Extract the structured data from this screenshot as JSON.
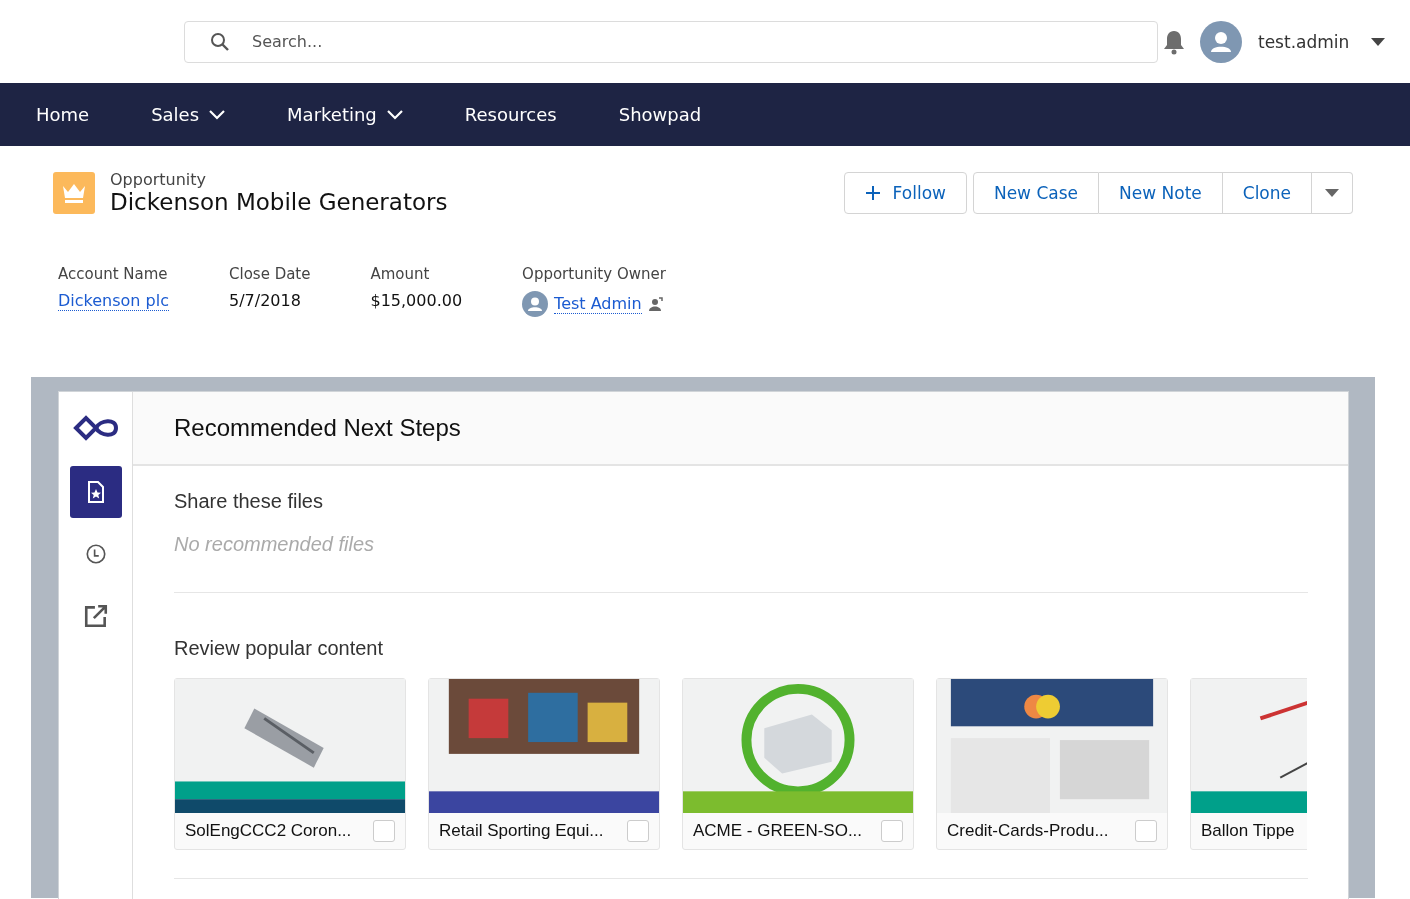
{
  "search": {
    "placeholder": "Search..."
  },
  "user": {
    "name": "test.admin"
  },
  "nav": [
    {
      "label": "Home",
      "has_menu": false
    },
    {
      "label": "Sales",
      "has_menu": true
    },
    {
      "label": "Marketing",
      "has_menu": true
    },
    {
      "label": "Resources",
      "has_menu": false
    },
    {
      "label": "Showpad",
      "has_menu": false
    }
  ],
  "record": {
    "type": "Opportunity",
    "title": "Dickenson Mobile Generators"
  },
  "actions": [
    {
      "label": "Follow",
      "kind": "follow"
    },
    {
      "label": "New Case",
      "kind": "button"
    },
    {
      "label": "New Note",
      "kind": "button"
    },
    {
      "label": "Clone",
      "kind": "button"
    },
    {
      "kind": "menu"
    }
  ],
  "fields": [
    {
      "label": "Account Name",
      "value": "Dickenson plc",
      "kind": "link"
    },
    {
      "label": "Close Date",
      "value": "5/7/2018",
      "kind": "text"
    },
    {
      "label": "Amount",
      "value": "$15,000.00",
      "kind": "text"
    },
    {
      "label": "Opportunity Owner",
      "value": "Test Admin",
      "kind": "user"
    }
  ],
  "rail": [
    {
      "kind": "recommended",
      "selected": true
    },
    {
      "kind": "recent",
      "selected": false
    },
    {
      "kind": "share",
      "selected": false
    }
  ],
  "panel": {
    "title": "Recommended Next Steps",
    "share_heading": "Share these files",
    "share_empty": "No recommended files",
    "popular_heading": "Review popular content",
    "files": [
      {
        "name": "SolEngCCC2 Coron...",
        "checked": false,
        "kind": "picture"
      },
      {
        "name": "Retail Sporting Equi...",
        "checked": false,
        "kind": "picture"
      },
      {
        "name": "ACME - GREEN-SO...",
        "checked": false,
        "kind": "picture"
      },
      {
        "name": "Credit-Cards-Produ...",
        "checked": false,
        "kind": "picture"
      },
      {
        "name": "Ballon Tippe",
        "kind": "picture"
      }
    ]
  }
}
